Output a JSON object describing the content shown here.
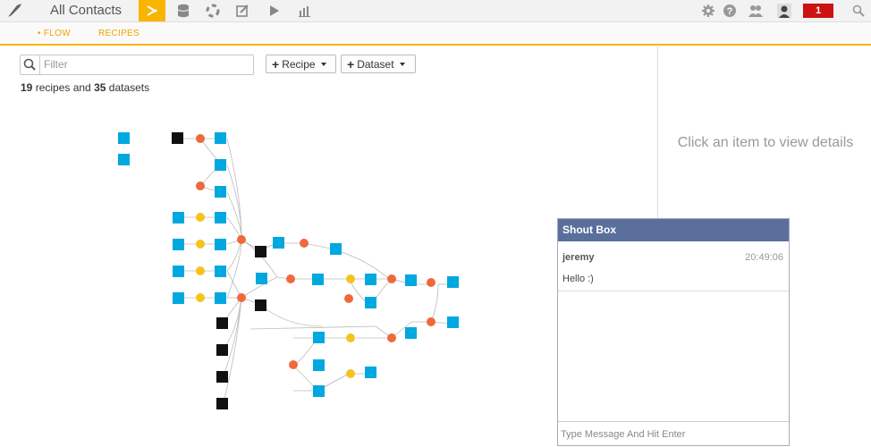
{
  "app": {
    "title": "All Contacts",
    "nav_icons": [
      "flow-icon",
      "datasets-icon",
      "lifebuoy-icon",
      "notebook-icon",
      "play-icon",
      "chart-icon"
    ],
    "right_icons": [
      "gear-icon",
      "help-icon",
      "users-icon",
      "avatar"
    ],
    "notification_count": "1"
  },
  "subnav": {
    "flow_label": "• FLOW",
    "recipes_label": "RECIPES"
  },
  "toolbar": {
    "filter_placeholder": "Filter",
    "recipe_label": "Recipe",
    "dataset_label": "Dataset"
  },
  "summary": {
    "recipes_count": "19",
    "recipes_text": " recipes and ",
    "datasets_count": "35",
    "datasets_text": " datasets"
  },
  "details_panel": {
    "placeholder": "Click an item to view details"
  },
  "colors": {
    "accent": "#f8b500",
    "dataset": "#00a8e0",
    "recipe_python": "#f0693a",
    "recipe_prepare": "#f6c31c",
    "dataset_dark": "#111111",
    "shout_header": "#5a6f9c",
    "notification": "#cc1111"
  },
  "shout_box": {
    "title": "Shout Box",
    "messages": [
      {
        "user": "jeremy",
        "time": "20:49:06",
        "text": "Hello :)"
      }
    ],
    "input_placeholder": "Type Message And Hit Enter"
  }
}
